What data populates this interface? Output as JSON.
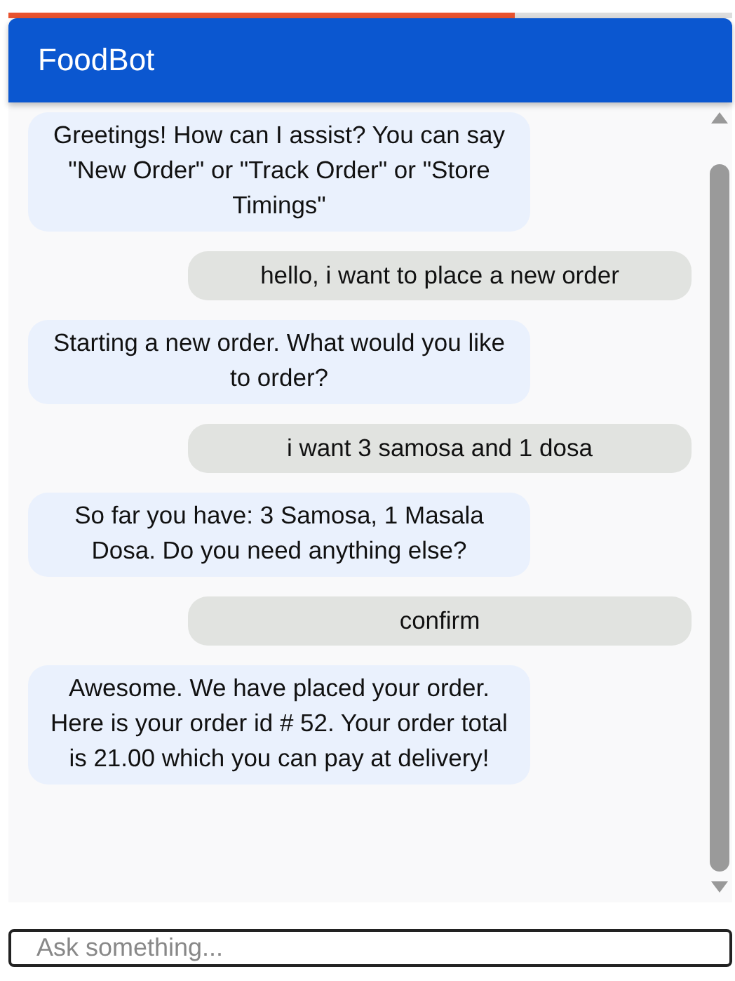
{
  "progress": {
    "level": 0.7
  },
  "header": {
    "title": "FoodBot"
  },
  "messages": [
    {
      "kind": "bot",
      "text": "Greetings! How can I assist? You can say \"New Order\" or \"Track Order\" or \"Store Timings\""
    },
    {
      "kind": "user",
      "text": "hello, i want to place a new order"
    },
    {
      "kind": "bot",
      "text": "Starting a new order. What would you like to order?"
    },
    {
      "kind": "user",
      "text": "i want 3 samosa and 1 dosa"
    },
    {
      "kind": "bot",
      "text": "So far you have: 3 Samosa, 1 Masala Dosa. Do you need anything else?"
    },
    {
      "kind": "user",
      "text": "confirm"
    },
    {
      "kind": "bot",
      "text": "Awesome. We have placed your order. Here is your order id # 52. Your order total is 21.00 which you can pay at delivery!"
    }
  ],
  "input": {
    "placeholder": "Ask something..."
  }
}
